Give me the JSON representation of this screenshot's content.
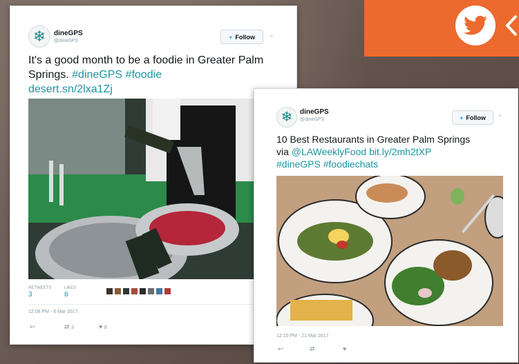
{
  "tweet1": {
    "user_name": "dineGPS",
    "handle": "@dineGPS",
    "follow_label": "Follow",
    "text": "It's a good month to be a foodie in Greater Palm Springs.",
    "hashtag1": "#dineGPS",
    "hashtag2": "#foodie",
    "link": "desert.sn/2lxa1Zj",
    "retweets_label": "RETWEETS",
    "retweets_count": "3",
    "likes_label": "LIKES",
    "likes_count": "8",
    "timestamp": "12:08 PM - 8 Mar 2017",
    "retweet_action_count": "3",
    "like_action_count": "8",
    "liker_colors": [
      "#3a2f2a",
      "#8a5a32",
      "#2e3a32",
      "#a84a3c",
      "#2d2d2d",
      "#6c6c6c",
      "#3d7a9c",
      "#b23a3a"
    ]
  },
  "tweet2": {
    "user_name": "dineGPS",
    "handle": "@dineGPS",
    "follow_label": "Follow",
    "text_line1": "10 Best Restaurants in Greater Palm Springs",
    "via": "via",
    "mention": "@LAWeeklyFood",
    "link": "bit.ly/2mh2tXP",
    "hashtag1": "#dineGPS",
    "hashtag2": "#foodiechats",
    "timestamp": "12:10 PM - 21 Mar 2017"
  },
  "colors": {
    "accent_orange": "#ec6a2d",
    "link_teal": "#1b95a0",
    "twitter_blue": "#1da1f2"
  },
  "icons": [
    "twitter-bird-icon",
    "chevron-left-icon",
    "snowflake-logo-icon",
    "follow-person-plus-icon",
    "caret-down-icon",
    "reply-icon",
    "retweet-icon",
    "heart-icon"
  ]
}
